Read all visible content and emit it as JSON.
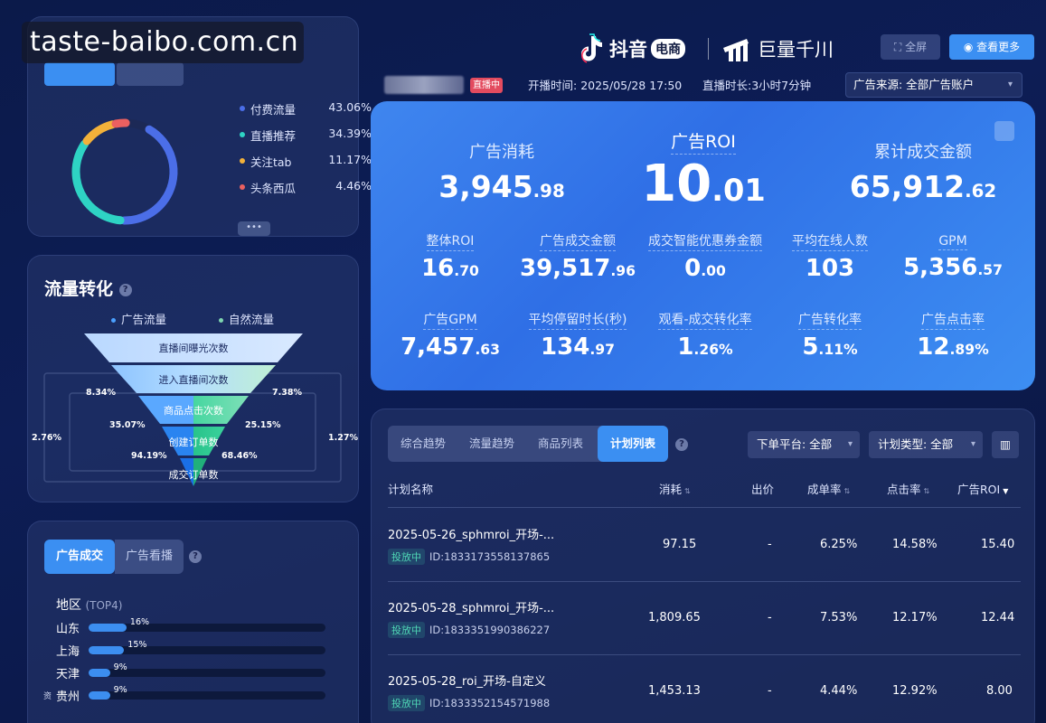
{
  "watermark": "taste-baibo.com.cn",
  "brand": {
    "douyin": "抖音",
    "ecom": "电商",
    "qianchuan": "巨量千川"
  },
  "header": {
    "fullscreen_label": "全屏",
    "view_more_label": "查看更多",
    "live_badge": "直播中",
    "start_time_label": "开播时间:",
    "start_time": "2025/05/28 17:50",
    "duration_label": "直播时长:",
    "duration": "3小时7分钟",
    "ad_source": "广告来源: 全部广告账户"
  },
  "traffic_source": {
    "items": [
      {
        "label": "付费流量",
        "value": "43.06%",
        "color": "#4b6ee8"
      },
      {
        "label": "直播推荐",
        "value": "34.39%",
        "color": "#2ed3c4"
      },
      {
        "label": "关注tab",
        "value": "11.17%",
        "color": "#f2b13a"
      },
      {
        "label": "头条西瓜",
        "value": "4.46%",
        "color": "#ea6060"
      }
    ],
    "more": "•••"
  },
  "funnel": {
    "title": "流量转化",
    "legend": [
      "广告流量",
      "自然流量"
    ],
    "stages": [
      "直播间曝光次数",
      "进入直播间次数",
      "商品点击次数",
      "创建订单数",
      "成交订单数"
    ],
    "left_rates": [
      "8.34%",
      "35.07%",
      "94.19%"
    ],
    "right_rates": [
      "7.38%",
      "25.15%",
      "68.46%"
    ],
    "outer_left": "2.76%",
    "outer_right": "1.27%"
  },
  "region": {
    "tabs": [
      "广告成交",
      "广告看播"
    ],
    "title": "地区",
    "title_suffix": "(TOP4)",
    "side_char": "资",
    "rows": [
      {
        "name": "山东",
        "value": "16%",
        "fraction": 0.16
      },
      {
        "name": "上海",
        "value": "15%",
        "fraction": 0.15
      },
      {
        "name": "天津",
        "value": "9%",
        "fraction": 0.09
      },
      {
        "name": "贵州",
        "value": "9%",
        "fraction": 0.09
      }
    ]
  },
  "kpi": {
    "ad_spend": {
      "label": "广告消耗",
      "int": "3,945",
      "frac": ".98"
    },
    "ad_roi": {
      "label": "广告ROI",
      "int": "10",
      "frac": ".01"
    },
    "total_gmv": {
      "label": "累计成交金额",
      "int": "65,912",
      "frac": ".62"
    },
    "row2": [
      {
        "label": "整体ROI",
        "int": "16",
        "frac": ".70"
      },
      {
        "label": "广告成交金额",
        "int": "39,517",
        "frac": ".96"
      },
      {
        "label": "成交智能优惠券金额",
        "int": "0",
        "frac": ".00"
      },
      {
        "label": "平均在线人数",
        "int": "103",
        "frac": ""
      },
      {
        "label": "GPM",
        "int": "5,356",
        "frac": ".57"
      }
    ],
    "row3": [
      {
        "label": "广告GPM",
        "int": "7,457",
        "frac": ".63"
      },
      {
        "label": "平均停留时长(秒)",
        "int": "134",
        "frac": ".97"
      },
      {
        "label": "观看-成交转化率",
        "int": "1",
        "frac": ".26%"
      },
      {
        "label": "广告转化率",
        "int": "5",
        "frac": ".11%"
      },
      {
        "label": "广告点击率",
        "int": "12",
        "frac": ".89%"
      }
    ]
  },
  "table": {
    "tabs": [
      "综合趋势",
      "流量趋势",
      "商品列表",
      "计划列表"
    ],
    "active_tab": 3,
    "filter_platform": "下单平台: 全部",
    "filter_type": "计划类型: 全部",
    "columns": [
      "计划名称",
      "消耗",
      "出价",
      "成单率",
      "点击率",
      "广告ROI"
    ],
    "rows": [
      {
        "name": "2025-05-26_sphmroi_开场-...",
        "status": "投放中",
        "id": "ID:1833173558137865",
        "spend": "97.15",
        "bid": "-",
        "order_rate": "6.25%",
        "ctr": "14.58%",
        "roi": "15.40"
      },
      {
        "name": "2025-05-28_sphmroi_开场-...",
        "status": "投放中",
        "id": "ID:1833351990386227",
        "spend": "1,809.65",
        "bid": "-",
        "order_rate": "7.53%",
        "ctr": "12.17%",
        "roi": "12.44"
      },
      {
        "name": "2025-05-28_roi_开场-自定义",
        "status": "投放中",
        "id": "ID:1833352154571988",
        "spend": "1,453.13",
        "bid": "-",
        "order_rate": "4.44%",
        "ctr": "12.92%",
        "roi": "8.00"
      }
    ]
  }
}
